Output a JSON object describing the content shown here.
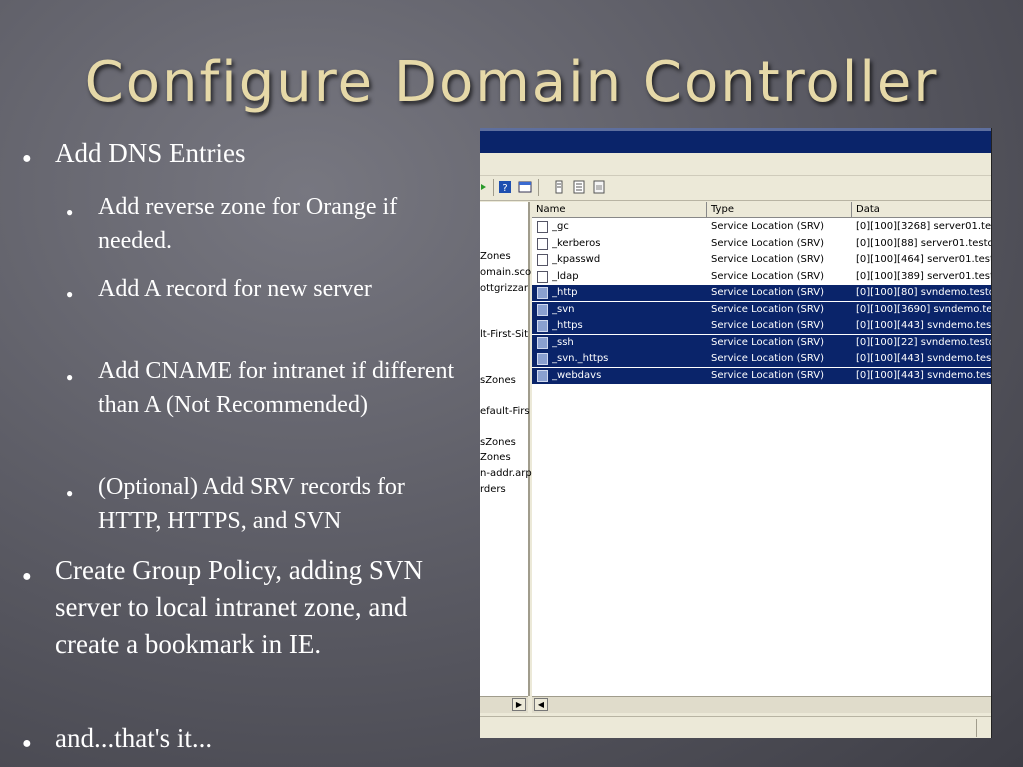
{
  "slide": {
    "title": "Configure Domain Controller",
    "bullets": [
      "Add DNS Entries",
      "Create Group Policy, adding SVN server to local intranet zone, and create a bookmark in IE.",
      "and...that's it..."
    ],
    "sub_bullets": [
      "Add reverse zone for Orange if needed.",
      "Add A record for new server",
      "Add CNAME for intranet if different than A (Not Recommended)",
      "(Optional) Add SRV records for HTTP, HTTPS, and SVN"
    ]
  },
  "dns_manager": {
    "tree_items": [
      "Zones",
      "omain.sco",
      "ottgrizzar",
      "lt-First-Sit",
      "sZones",
      "efault-Firs",
      "sZones",
      "Zones",
      "n-addr.arp",
      "rders"
    ],
    "columns": [
      "Name",
      "Type",
      "Data"
    ],
    "records": [
      {
        "name": "_gc",
        "type": "Service Location (SRV)",
        "data": "[0][100][3268] server01.tes",
        "selected": false
      },
      {
        "name": "_kerberos",
        "type": "Service Location (SRV)",
        "data": "[0][100][88] server01.testdo",
        "selected": false
      },
      {
        "name": "_kpasswd",
        "type": "Service Location (SRV)",
        "data": "[0][100][464] server01.testd",
        "selected": false
      },
      {
        "name": "_ldap",
        "type": "Service Location (SRV)",
        "data": "[0][100][389] server01.testd",
        "selected": false
      },
      {
        "name": "_http",
        "type": "Service Location (SRV)",
        "data": "[0][100][80] svndemo.testdo",
        "selected": true
      },
      {
        "name": "_svn",
        "type": "Service Location (SRV)",
        "data": "[0][100][3690] svndemo.tes",
        "selected": true
      },
      {
        "name": "_https",
        "type": "Service Location (SRV)",
        "data": "[0][100][443] svndemo.testd",
        "selected": true
      },
      {
        "name": "_ssh",
        "type": "Service Location (SRV)",
        "data": "[0][100][22] svndemo.testdo",
        "selected": true
      },
      {
        "name": "_svn._https",
        "type": "Service Location (SRV)",
        "data": "[0][100][443] svndemo.testd",
        "selected": true
      },
      {
        "name": "_webdavs",
        "type": "Service Location (SRV)",
        "data": "[0][100][443] svndemo.testd",
        "selected": true
      }
    ]
  },
  "colors": {
    "title": "#e6d9a8",
    "selection": "#0a246a",
    "window_chrome": "#ece9d8"
  }
}
